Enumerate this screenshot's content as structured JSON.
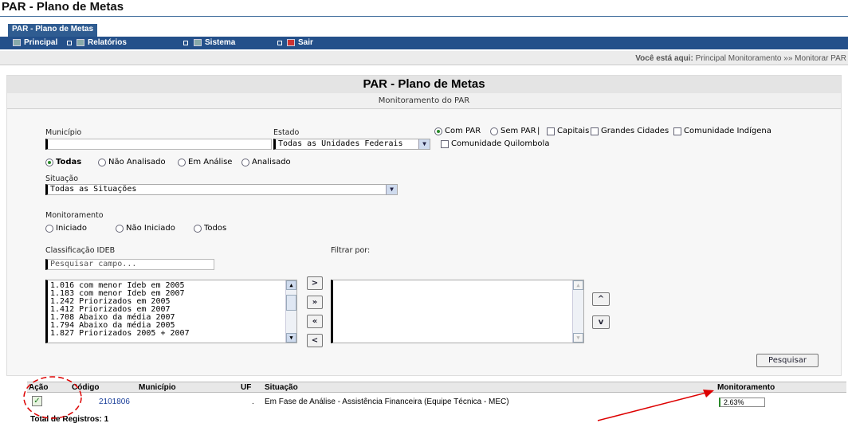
{
  "app_title": "PAR - Plano de Metas",
  "tab_label": "PAR - Plano de Metas",
  "menu": {
    "principal": "Principal",
    "relatorios": "Relatórios",
    "sistema": "Sistema",
    "sair": "Sair"
  },
  "breadcrumb": {
    "prefix": "Você está aqui:",
    "path": "Principal Monitoramento »» Monitorar PAR"
  },
  "panel": {
    "title": "PAR - Plano de Metas",
    "subtitle": "Monitoramento do PAR"
  },
  "filters": {
    "municipio_label": "Município",
    "municipio_value": "",
    "estado_label": "Estado",
    "estado_value": "Todas as Unidades Federais",
    "com_par": "Com PAR",
    "sem_par": "Sem PAR",
    "sep": "|",
    "capitais": "Capitais",
    "grandes_cidades": "Grandes Cidades",
    "comunidade_indigena": "Comunidade Indígena",
    "comunidade_quilombola": "Comunidade Quilombola",
    "status_todas": "Todas",
    "status_nao_analisado": "Não Analisado",
    "status_em_analise": "Em Análise",
    "status_analisado": "Analisado",
    "situacao_label": "Situação",
    "situacao_value": "Todas as Situações",
    "monitoramento_label": "Monitoramento",
    "mon_iniciado": "Iniciado",
    "mon_nao_iniciado": "Não Iniciado",
    "mon_todos": "Todos",
    "ideb_label": "Classificação IDEB",
    "search_placeholder": "Pesquisar campo...",
    "filtrar_por_label": "Filtrar por:",
    "ideb_options": [
      "1.016 com menor Ideb em 2005",
      "1.183 com menor Ideb em 2007",
      "1.242 Priorizados em 2005",
      "1.412 Priorizados em 2007",
      "1.708 Abaixo da média 2007",
      "1.794 Abaixo da média 2005",
      "1.827 Priorizados 2005 + 2007"
    ],
    "btn_move_one": ">",
    "btn_move_all": "»",
    "btn_remove_all": "«",
    "btn_remove_one": "<",
    "btn_up": "^",
    "btn_down": "v",
    "pesquisar_label": "Pesquisar"
  },
  "table": {
    "headers": {
      "acao": "Ação",
      "codigo": "Código",
      "municipio": "Município",
      "uf": "UF",
      "situacao": "Situação",
      "monitoramento": "Monitoramento"
    },
    "rows": [
      {
        "codigo": "2101806",
        "municipio": "",
        "uf": ".",
        "situacao": "Em Fase de Análise - Assistência Financeira (Equipe Técnica - MEC)",
        "monitoramento": "2.63%"
      }
    ],
    "total": "Total de Registros: 1"
  }
}
